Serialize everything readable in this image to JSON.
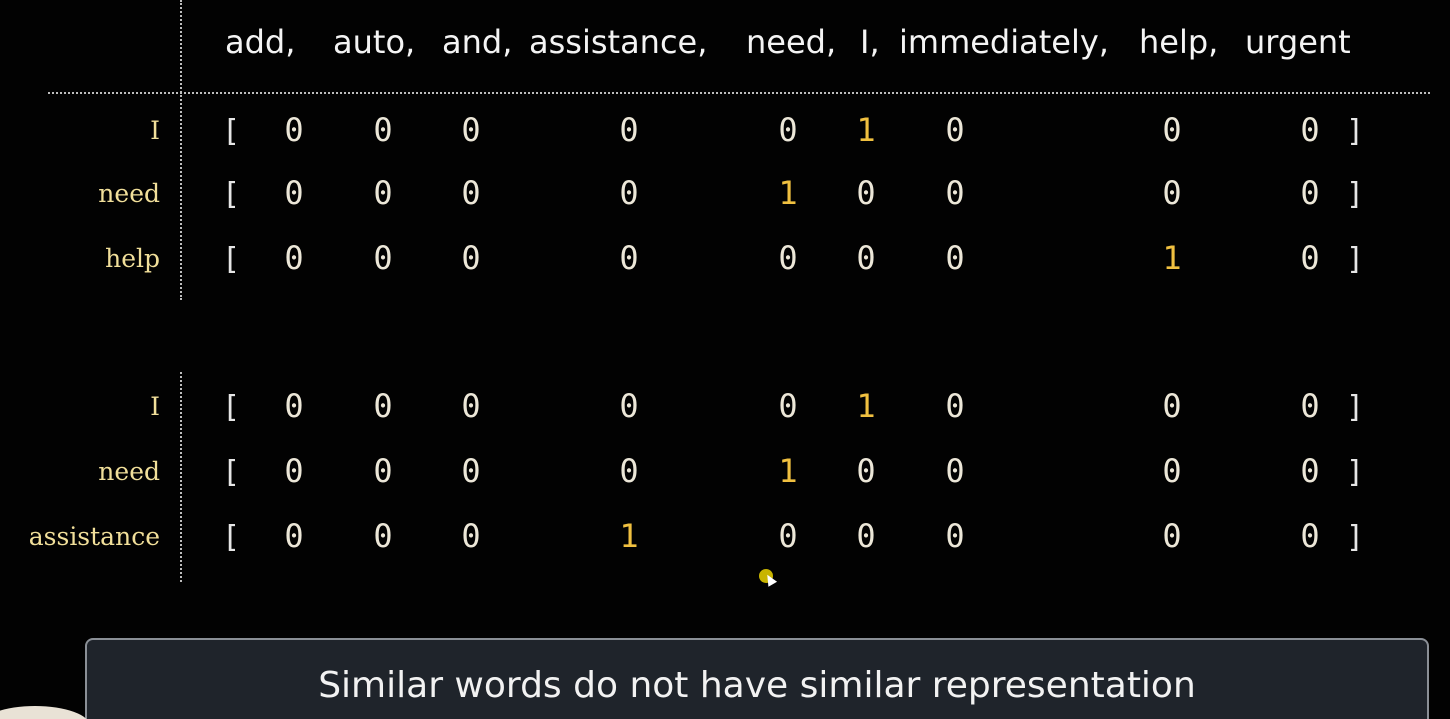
{
  "vocabulary": [
    "add,",
    "auto,",
    "and,",
    "assistance,",
    "need,",
    "I,",
    "immediately,",
    "help,",
    "urgent"
  ],
  "bracket_open": "[",
  "bracket_close": "]",
  "groups": [
    {
      "rows": [
        {
          "label": "I",
          "vector": [
            "0",
            "0",
            "0",
            "0",
            "0",
            "1",
            "0",
            "0",
            "0"
          ]
        },
        {
          "label": "need",
          "vector": [
            "0",
            "0",
            "0",
            "0",
            "1",
            "0",
            "0",
            "0",
            "0"
          ]
        },
        {
          "label": "help",
          "vector": [
            "0",
            "0",
            "0",
            "0",
            "0",
            "0",
            "0",
            "1",
            "0"
          ]
        }
      ]
    },
    {
      "rows": [
        {
          "label": "I",
          "vector": [
            "0",
            "0",
            "0",
            "0",
            "0",
            "1",
            "0",
            "0",
            "0"
          ]
        },
        {
          "label": "need",
          "vector": [
            "0",
            "0",
            "0",
            "0",
            "1",
            "0",
            "0",
            "0",
            "0"
          ]
        },
        {
          "label": "assistance",
          "vector": [
            "0",
            "0",
            "0",
            "1",
            "0",
            "0",
            "0",
            "0",
            "0"
          ]
        }
      ]
    }
  ],
  "caption": "Similar words do not have similar representation",
  "colors": {
    "background": "#020202",
    "one_value": "#f0c040",
    "zero_value": "#ece7d8",
    "label": "#f1df9a",
    "caption_box": "#1f242b"
  }
}
